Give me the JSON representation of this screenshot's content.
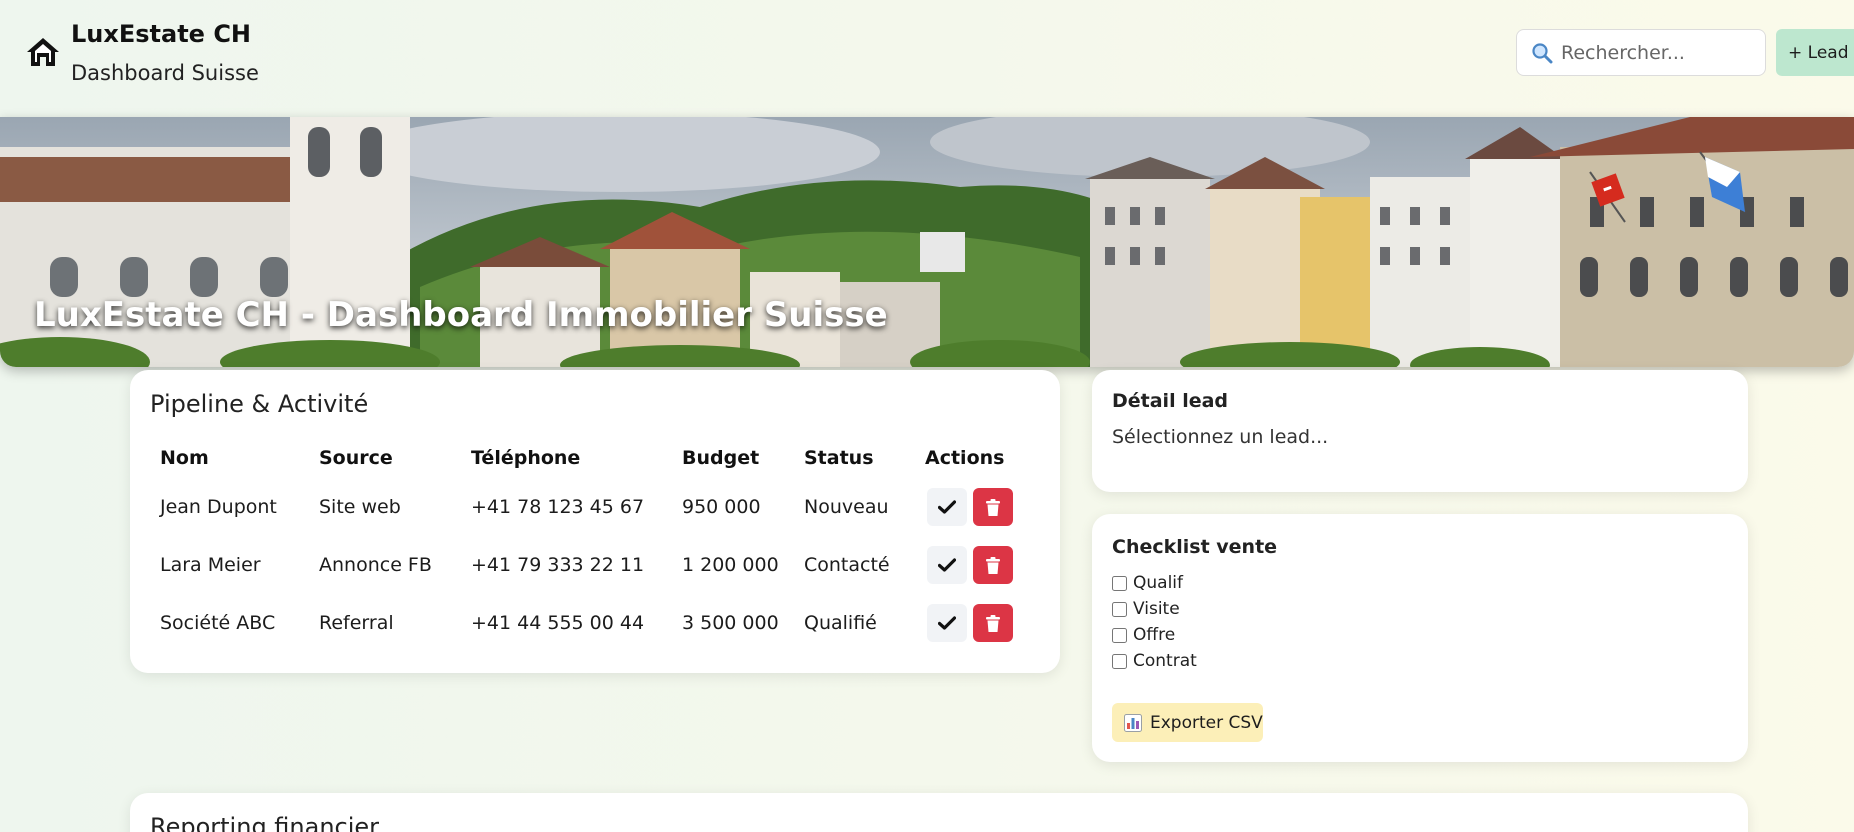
{
  "header": {
    "brand_title": "LuxEstate CH",
    "brand_subtitle": "Dashboard Suisse",
    "search_placeholder": "Rechercher...",
    "lead_button": "+ Lead"
  },
  "hero": {
    "title": "LuxEstate CH - Dashboard Immobilier Suisse"
  },
  "pipeline": {
    "title": "Pipeline & Activité",
    "columns": [
      "Nom",
      "Source",
      "Téléphone",
      "Budget",
      "Status",
      "Actions"
    ],
    "rows": [
      {
        "nom": "Jean Dupont",
        "source": "Site web",
        "telephone": "+41 78 123 45 67",
        "budget": "950 000",
        "status": "Nouveau"
      },
      {
        "nom": "Lara Meier",
        "source": "Annonce FB",
        "telephone": "+41 79 333 22 11",
        "budget": "1 200 000",
        "status": "Contacté"
      },
      {
        "nom": "Société ABC",
        "source": "Referral",
        "telephone": "+41 44 555 00 44",
        "budget": "3 500 000",
        "status": "Qualifié"
      }
    ]
  },
  "detail": {
    "title": "Détail lead",
    "placeholder": "Sélectionnez un lead..."
  },
  "checklist": {
    "title": "Checklist vente",
    "items": [
      "Qualif",
      "Visite",
      "Offre",
      "Contrat"
    ],
    "export_button": "Exporter CSV"
  },
  "reporting": {
    "title": "Reporting financier"
  },
  "colors": {
    "lead_button": "#bde7cf",
    "delete_button": "#dc3545",
    "export_button": "#fcefb8"
  }
}
